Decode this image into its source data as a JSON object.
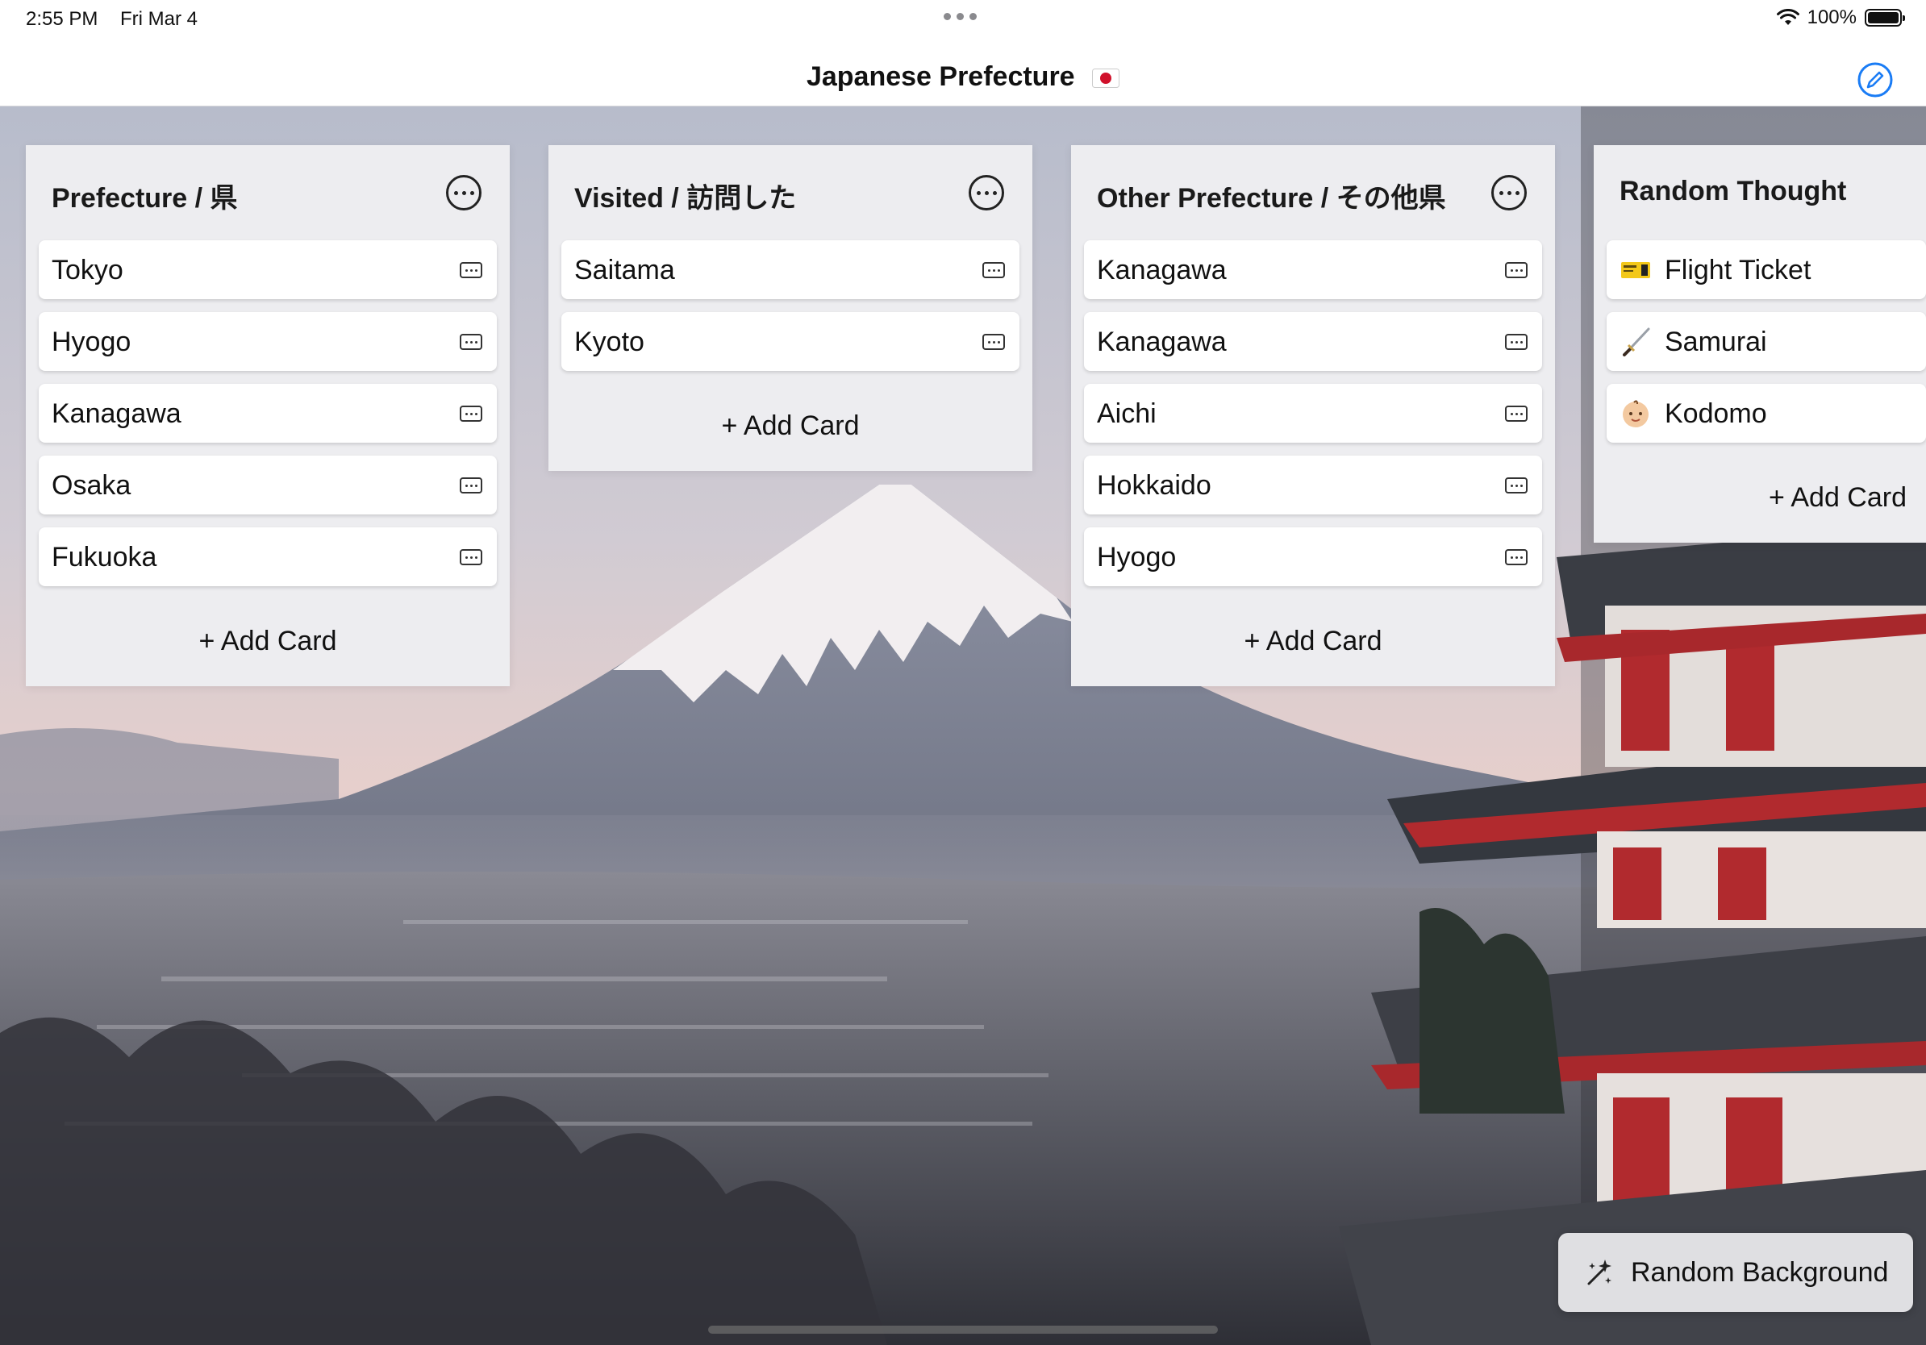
{
  "status_bar": {
    "time": "2:55 PM",
    "date": "Fri Mar 4",
    "battery": "100%"
  },
  "nav": {
    "title": "Japanese Prefecture",
    "flag_icon": "japan-flag-icon",
    "edit_icon": "pencil-circle-icon"
  },
  "columns": [
    {
      "title": "Prefecture / 県",
      "cards": [
        "Tokyo",
        "Hyogo",
        "Kanagawa",
        "Osaka",
        "Fukuoka"
      ],
      "add_label": "+ Add Card"
    },
    {
      "title": "Visited / 訪問した",
      "cards": [
        "Saitama",
        "Kyoto"
      ],
      "add_label": "+ Add Card"
    },
    {
      "title": "Other Prefecture / その他県",
      "cards": [
        "Kanagawa",
        "Kanagawa",
        "Aichi",
        "Hokkaido",
        "Hyogo"
      ],
      "add_label": "+ Add Card"
    },
    {
      "title": "Random Thought",
      "cards": [
        {
          "label": "Flight Ticket",
          "icon": "ticket-emoji-icon"
        },
        {
          "label": "Samurai",
          "icon": "sword-emoji-icon"
        },
        {
          "label": "Kodomo",
          "icon": "baby-emoji-icon"
        }
      ],
      "add_label": "+ Add Card"
    }
  ],
  "floating_button": {
    "label": "Random Background",
    "icon": "sparkles-icon"
  },
  "colors": {
    "accent": "#1a7cf5",
    "column_bg": "#ededf0",
    "card_bg": "#ffffff"
  }
}
